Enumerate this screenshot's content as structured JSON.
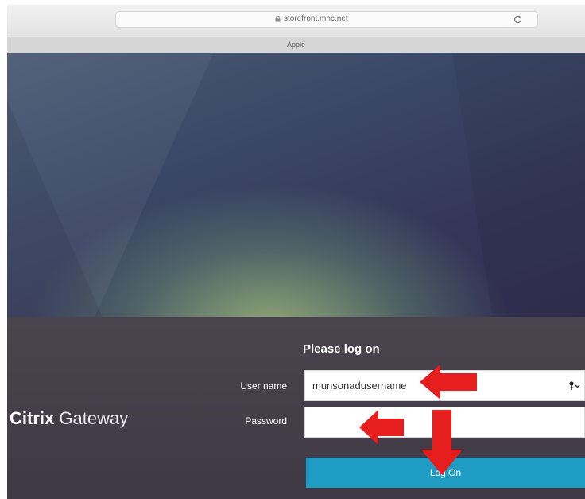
{
  "browser": {
    "address": "storefront.mhc.net",
    "tab_title": "Apple"
  },
  "login": {
    "brand_bold": "Citrix",
    "brand_light": "Gateway",
    "title": "Please log on",
    "username_label": "User name",
    "username_value": "munsonadusername",
    "password_label": "Password",
    "password_value": "",
    "button_label": "Log On"
  },
  "annotations": {
    "arrow_color": "#e61e1e"
  },
  "icons": {
    "lock": "lock-icon",
    "reload": "reload-icon",
    "key": "key-icon"
  },
  "colors": {
    "panel": "#433e48",
    "button": "#1f9cc4"
  }
}
